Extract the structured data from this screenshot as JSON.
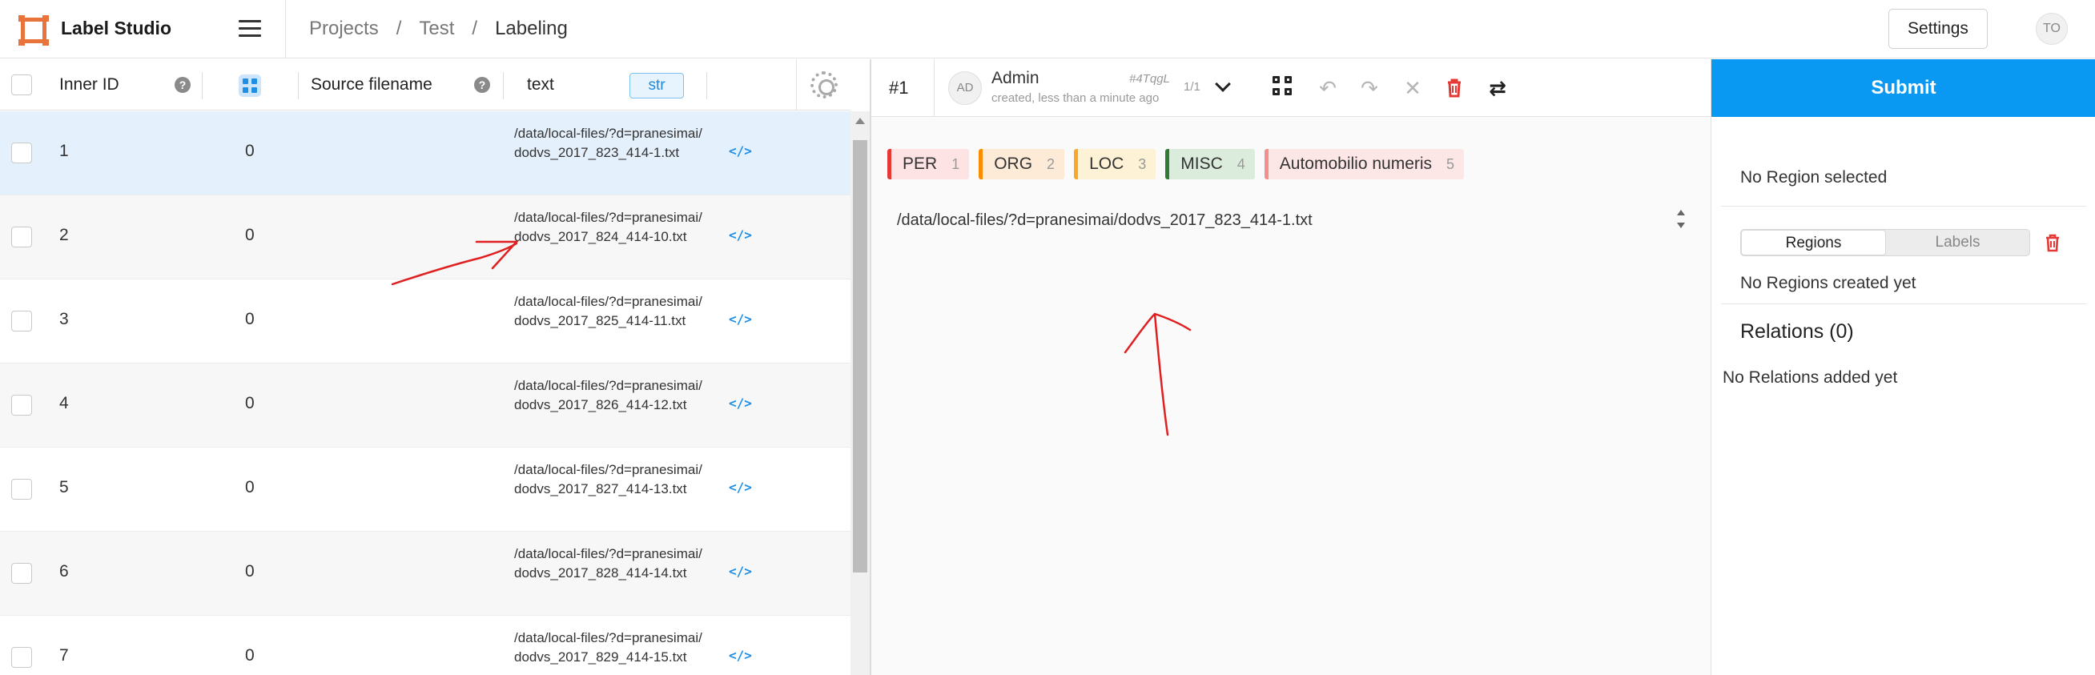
{
  "header": {
    "app_title": "Label Studio",
    "breadcrumb": [
      "Projects",
      "Test",
      "Labeling"
    ],
    "settings_label": "Settings",
    "user_initials": "TO"
  },
  "table": {
    "columns": {
      "inner_id": "Inner ID",
      "source_filename": "Source filename",
      "text": "text",
      "text_type": "str"
    },
    "rows": [
      {
        "id": "1",
        "count": "0",
        "text": "/data/local-files/?d=pranesimai/dodvs_2017_823_414-1.txt",
        "selected": true
      },
      {
        "id": "2",
        "count": "0",
        "text": "/data/local-files/?d=pranesimai/dodvs_2017_824_414-10.txt",
        "selected": false
      },
      {
        "id": "3",
        "count": "0",
        "text": "/data/local-files/?d=pranesimai/dodvs_2017_825_414-11.txt",
        "selected": false
      },
      {
        "id": "4",
        "count": "0",
        "text": "/data/local-files/?d=pranesimai/dodvs_2017_826_414-12.txt",
        "selected": false
      },
      {
        "id": "5",
        "count": "0",
        "text": "/data/local-files/?d=pranesimai/dodvs_2017_827_414-13.txt",
        "selected": false
      },
      {
        "id": "6",
        "count": "0",
        "text": "/data/local-files/?d=pranesimai/dodvs_2017_828_414-14.txt",
        "selected": false
      },
      {
        "id": "7",
        "count": "0",
        "text": "/data/local-files/?d=pranesimai/dodvs_2017_829_414-15.txt",
        "selected": false
      }
    ]
  },
  "annotation": {
    "task_id": "#1",
    "avatar": "AD",
    "annotator": "Admin",
    "created": "created, less than a minute ago",
    "hash": "#4TqgL",
    "count": "1/1"
  },
  "labels": [
    {
      "name": "PER",
      "hotkey": "1",
      "color": "#e53935",
      "bg": "#fde3e3"
    },
    {
      "name": "ORG",
      "hotkey": "2",
      "color": "#fb8c00",
      "bg": "#fdebd8"
    },
    {
      "name": "LOC",
      "hotkey": "3",
      "color": "#f9a825",
      "bg": "#fdf1d6"
    },
    {
      "name": "MISC",
      "hotkey": "4",
      "color": "#2e7d32",
      "bg": "#dcecdc"
    },
    {
      "name": "Automobilio numeris",
      "hotkey": "5",
      "color": "#f48f8f",
      "bg": "#fde6e6"
    }
  ],
  "document_text": "/data/local-files/?d=pranesimai/dodvs_2017_823_414-1.txt",
  "sidebar": {
    "submit_label": "Submit",
    "no_region": "No Region selected",
    "tabs": [
      "Regions",
      "Labels"
    ],
    "no_regions": "No Regions created yet",
    "relations_title": "Relations (0)",
    "no_relations": "No Relations added yet"
  },
  "colors": {
    "accent": "#0a99f2",
    "logo": "#e8743b",
    "annotation_ink": "#e02020",
    "delete": "#e53935"
  }
}
